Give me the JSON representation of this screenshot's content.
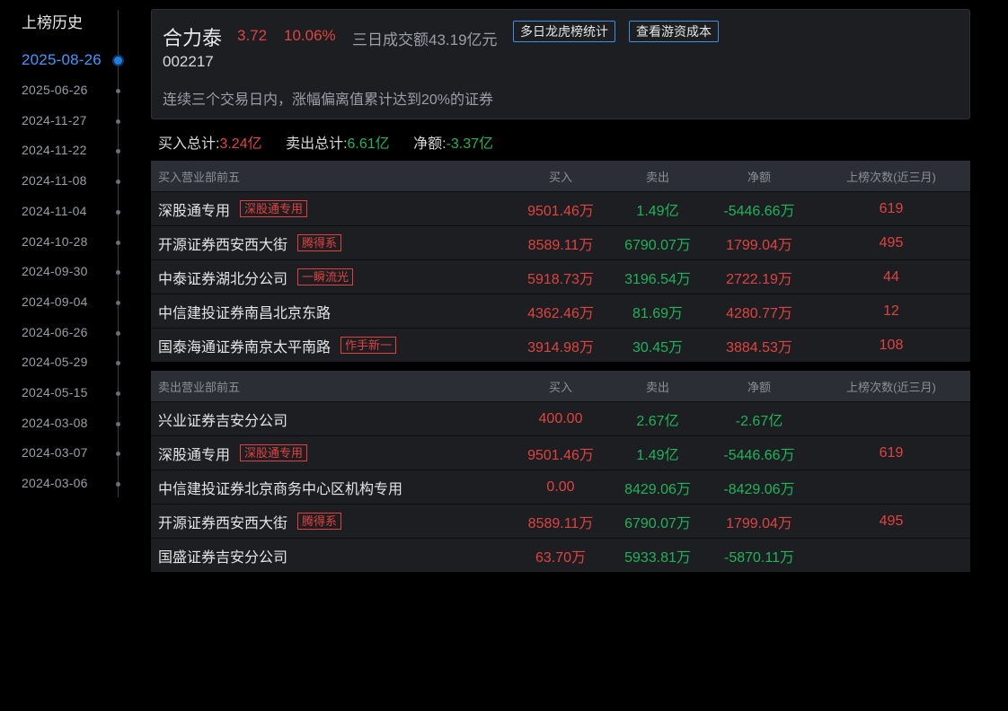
{
  "sidebar": {
    "title": "上榜历史",
    "dates": [
      {
        "label": "2025-08-26",
        "active": true
      },
      {
        "label": "2025-06-26"
      },
      {
        "label": "2024-11-27"
      },
      {
        "label": "2024-11-22"
      },
      {
        "label": "2024-11-08"
      },
      {
        "label": "2024-11-04"
      },
      {
        "label": "2024-10-28"
      },
      {
        "label": "2024-09-30"
      },
      {
        "label": "2024-09-04"
      },
      {
        "label": "2024-06-26"
      },
      {
        "label": "2024-05-29"
      },
      {
        "label": "2024-05-15"
      },
      {
        "label": "2024-03-08"
      },
      {
        "label": "2024-03-07"
      },
      {
        "label": "2024-03-06"
      }
    ]
  },
  "stock": {
    "name": "合力泰",
    "price": "3.72",
    "change_pct": "10.06%",
    "turnover": "三日成交额43.19亿元",
    "code": "002217",
    "reason": "连续三个交易日内，涨幅偏离值累计达到20%的证券"
  },
  "header_buttons": {
    "multi_day": "多日龙虎榜统计",
    "cost": "查看游资成本"
  },
  "totals": {
    "buy_label": "买入总计:",
    "buy_value": "3.24亿",
    "sell_label": "卖出总计:",
    "sell_value": "6.61亿",
    "net_label": "净额:",
    "net_value": "-3.37亿"
  },
  "colors": {
    "up": "#e0433f",
    "down": "#1fb45a",
    "accent": "#3d9bff"
  },
  "buy_table": {
    "headers": {
      "name": "买入营业部前五",
      "buy": "买入",
      "sell": "卖出",
      "net": "净额",
      "count": "上榜次数(近三月)"
    },
    "rows": [
      {
        "name": "深股通专用",
        "tag": "深股通专用",
        "buy": "9501.46万",
        "sell": "1.49亿",
        "net": "-5446.66万",
        "net_dir": "down",
        "count": "619"
      },
      {
        "name": "开源证券西安西大街",
        "tag": "腾得系",
        "buy": "8589.11万",
        "sell": "6790.07万",
        "net": "1799.04万",
        "net_dir": "up",
        "count": "495"
      },
      {
        "name": "中泰证券湖北分公司",
        "tag": "一瞬流光",
        "buy": "5918.73万",
        "sell": "3196.54万",
        "net": "2722.19万",
        "net_dir": "up",
        "count": "44"
      },
      {
        "name": "中信建投证券南昌北京东路",
        "tag": "",
        "buy": "4362.46万",
        "sell": "81.69万",
        "net": "4280.77万",
        "net_dir": "up",
        "count": "12"
      },
      {
        "name": "国泰海通证券南京太平南路",
        "tag": "作手新一",
        "buy": "3914.98万",
        "sell": "30.45万",
        "net": "3884.53万",
        "net_dir": "up",
        "count": "108"
      }
    ]
  },
  "sell_table": {
    "headers": {
      "name": "卖出营业部前五",
      "buy": "买入",
      "sell": "卖出",
      "net": "净额",
      "count": "上榜次数(近三月)"
    },
    "rows": [
      {
        "name": "兴业证券吉安分公司",
        "tag": "",
        "buy": "400.00",
        "sell": "2.67亿",
        "net": "-2.67亿",
        "net_dir": "down",
        "count": ""
      },
      {
        "name": "深股通专用",
        "tag": "深股通专用",
        "buy": "9501.46万",
        "sell": "1.49亿",
        "net": "-5446.66万",
        "net_dir": "down",
        "count": "619"
      },
      {
        "name": "中信建投证券北京商务中心区机构专用",
        "tag": "",
        "buy": "0.00",
        "sell": "8429.06万",
        "net": "-8429.06万",
        "net_dir": "down",
        "count": ""
      },
      {
        "name": "开源证券西安西大街",
        "tag": "腾得系",
        "buy": "8589.11万",
        "sell": "6790.07万",
        "net": "1799.04万",
        "net_dir": "up",
        "count": "495"
      },
      {
        "name": "国盛证券吉安分公司",
        "tag": "",
        "buy": "63.70万",
        "sell": "5933.81万",
        "net": "-5870.11万",
        "net_dir": "down",
        "count": ""
      }
    ]
  }
}
